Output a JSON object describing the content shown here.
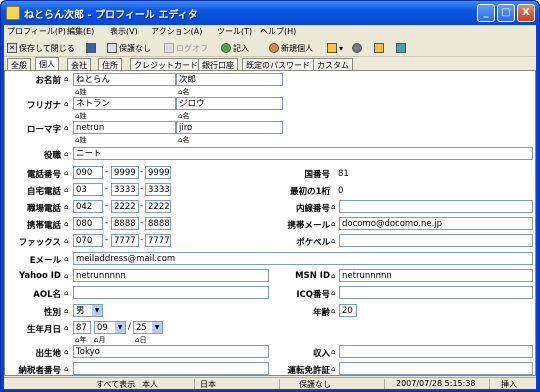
{
  "title": "ねとらん次郎 - プロフィール エディタ",
  "window_buttons": {
    "min": "_",
    "max": "□",
    "close": "X"
  },
  "menu": [
    "プロフィール(P)",
    "編集(E)",
    "表示(V)",
    "アクション(A)",
    "ツール(T)",
    "ヘルプ(H)"
  ],
  "toolbar": {
    "save_close": "保存して閉じる",
    "protect": "保護なし",
    "logoff": "ログオフ",
    "entry": "記入",
    "new_person": "新規個人"
  },
  "tabs": [
    "全般",
    "個人",
    "会社",
    "住所",
    "クレジットカード",
    "銀行口座",
    "既定のパスワード",
    "カスタム"
  ],
  "form": {
    "name_label": "お名前",
    "last_name": "ねとらん",
    "first_name": "次郎",
    "sei": "姓",
    "mei": "名",
    "furigana_label": "フリガナ",
    "last_kana": "ネトラン",
    "first_kana": "ジロウ",
    "romaji_label": "ローマ字",
    "last_romaji": "netrun",
    "first_romaji": "jiro",
    "title_label": "役職",
    "title_value": "ニート",
    "phone_label": "電話番号",
    "phone": [
      "090",
      "9999",
      "9999"
    ],
    "country_label": "国番号",
    "country_value": "81",
    "home_label": "自宅電話",
    "home": [
      "03",
      "3333",
      "3333"
    ],
    "first1_label": "最初の1桁",
    "first1_value": "0",
    "work_label": "職場電話",
    "work": [
      "042",
      "2222",
      "2222"
    ],
    "ext_label": "内線番号",
    "mobile_label": "携帯電話",
    "mobile": [
      "080",
      "8888",
      "8888"
    ],
    "mmail_label": "携帯メール",
    "mmail_value": "docomo@docomo.ne.jp",
    "fax_label": "ファックス",
    "fax": [
      "070",
      "7777",
      "7777"
    ],
    "pager_label": "ポケベル",
    "email_label": "Eメール",
    "email_value": "meiladdress@mail.com",
    "yahoo_label": "Yahoo ID",
    "yahoo_value": "netrunnnnn",
    "msn_label": "MSN ID",
    "msn_value": "netrunnnnn",
    "aol_label": "AOL名",
    "icq_label": "ICQ番号",
    "gender_label": "性別",
    "gender_value": "男",
    "age_label": "年齢",
    "age_value": "20",
    "birth_label": "生年月日",
    "birth_year": "87",
    "birth_month": "09",
    "birth_day": "25",
    "nen": "年",
    "tsuki": "月",
    "hi": "日",
    "birthplace_label": "出生地",
    "birthplace_value": "Tokyo",
    "income_label": "収入",
    "taxid_label": "納税者番号",
    "license_label": "運転免許証"
  },
  "status": {
    "show": "すべて表示",
    "person": "本人",
    "lang": "日本",
    "protect": "保護なし",
    "time": "2007/07/28 5:15:38",
    "mode": "挿入"
  }
}
